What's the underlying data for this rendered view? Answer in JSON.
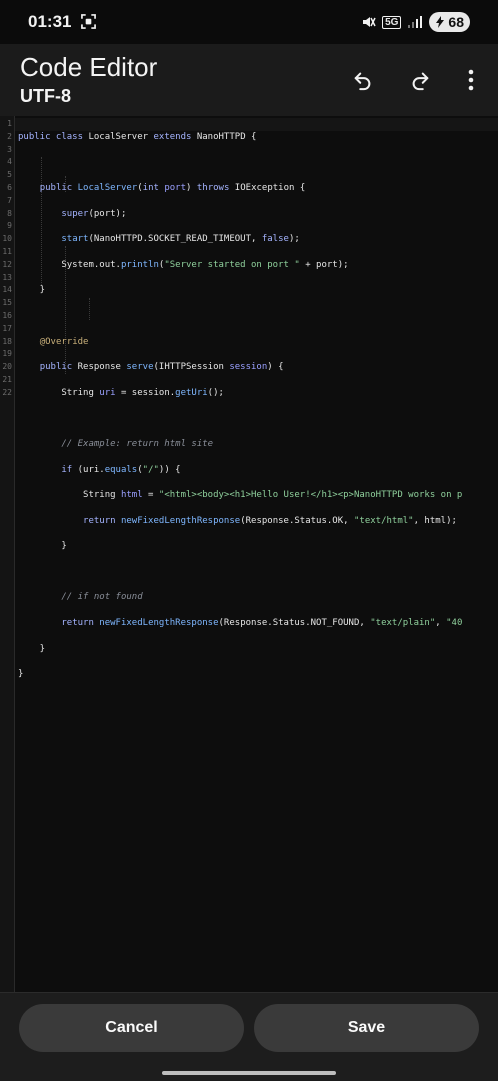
{
  "status_bar": {
    "time": "01:31",
    "network": "5G",
    "battery": "68"
  },
  "app_bar": {
    "title": "Code Editor",
    "encoding": "UTF-8",
    "undo_icon": "undo-icon",
    "redo_icon": "redo-icon",
    "more_icon": "more-vert-icon"
  },
  "editor": {
    "line_numbers": [
      "1",
      "2",
      "3",
      "4",
      "5",
      "6",
      "7",
      "8",
      "9",
      "10",
      "11",
      "12",
      "13",
      "14",
      "15",
      "16",
      "17",
      "18",
      "19",
      "20",
      "21",
      "22"
    ]
  },
  "buttons": {
    "cancel": "Cancel",
    "save": "Save"
  }
}
